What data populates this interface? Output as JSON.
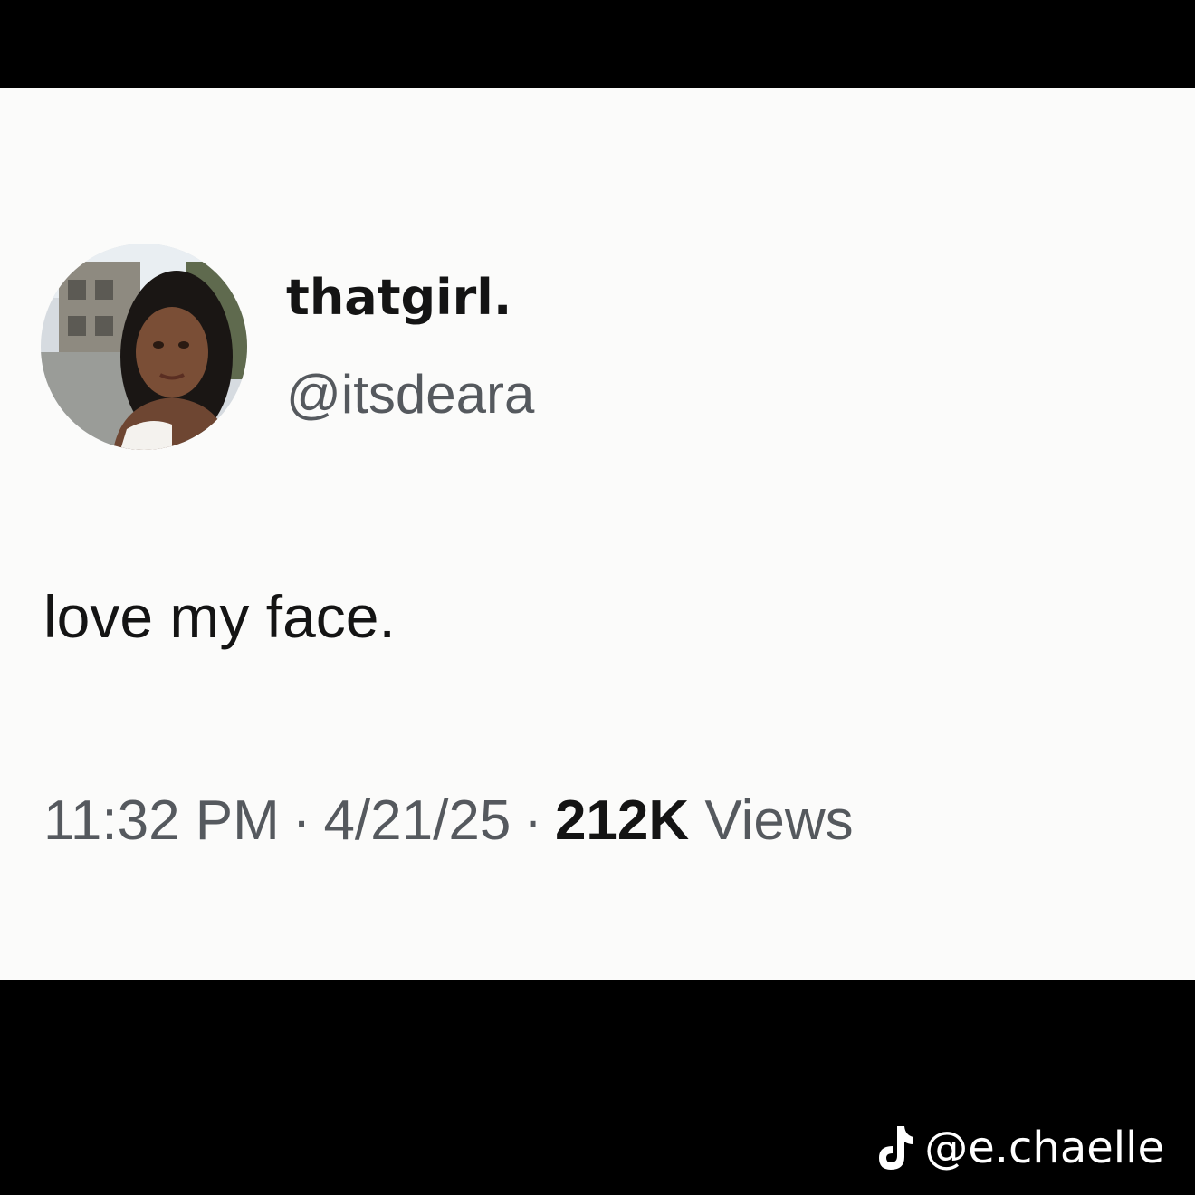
{
  "tweet": {
    "display_name": "thatgirl.",
    "handle": "@itsdeara",
    "text": "love my face.",
    "time": "11:32 PM",
    "date": "4/21/25",
    "separator": "·",
    "views_count": "212K",
    "views_label": "Views"
  },
  "watermark": {
    "icon": "tiktok-icon",
    "handle": "@e.chaelle"
  },
  "colors": {
    "background": "#000000",
    "card": "#fbfbfa",
    "primary_text": "#141414",
    "secondary_text": "#55595e"
  }
}
